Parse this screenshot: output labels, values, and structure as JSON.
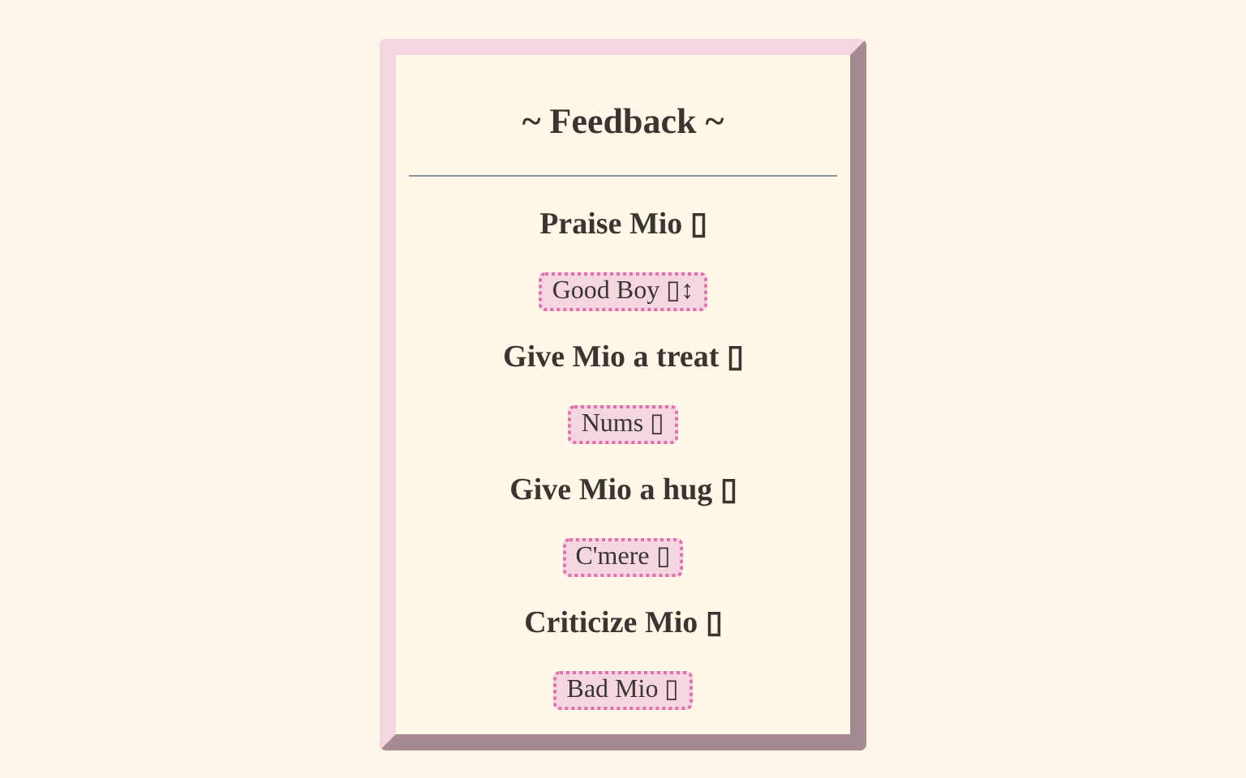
{
  "title": "~ Feedback ~",
  "sections": [
    {
      "heading": "Praise Mio ▯",
      "button": "Good Boy ▯↕"
    },
    {
      "heading": "Give Mio a treat ▯",
      "button": "Nums ▯"
    },
    {
      "heading": "Give Mio a hug ▯",
      "button": "C'mere ▯"
    },
    {
      "heading": "Criticize Mio ▯",
      "button": "Bad Mio ▯"
    }
  ]
}
